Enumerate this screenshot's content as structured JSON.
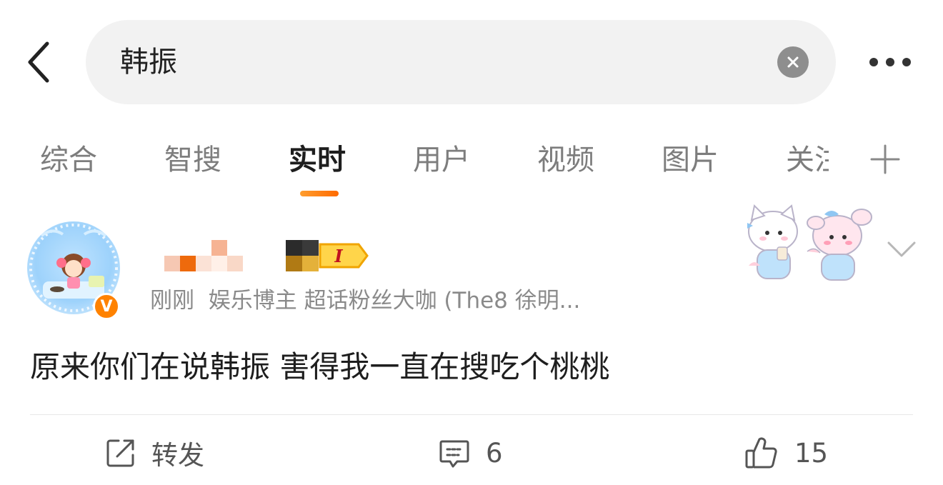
{
  "search": {
    "query": "韩振"
  },
  "tabs": [
    {
      "label": "综合"
    },
    {
      "label": "智搜"
    },
    {
      "label": "实时",
      "active": true
    },
    {
      "label": "用户"
    },
    {
      "label": "视频"
    },
    {
      "label": "图片"
    },
    {
      "label": "关注"
    }
  ],
  "post": {
    "time": "刚刚",
    "meta": "娱乐博主 超话粉丝大咖 (The8 徐明...",
    "verified_badge": "V",
    "level_badge": "I",
    "text": "原来你们在说韩振 害得我一直在搜吃个桃桃"
  },
  "actions": {
    "repost_label": "转发",
    "comment_count": "6",
    "like_count": "15"
  },
  "colors": {
    "accent": "#ff8200",
    "tab_indicator": "#ff7a18",
    "verified": "#ff8200"
  },
  "icons": [
    "back-arrow-icon",
    "clear-icon",
    "more-icon",
    "add-tab-icon",
    "chevron-down-icon",
    "repost-icon",
    "comment-icon",
    "like-icon"
  ]
}
